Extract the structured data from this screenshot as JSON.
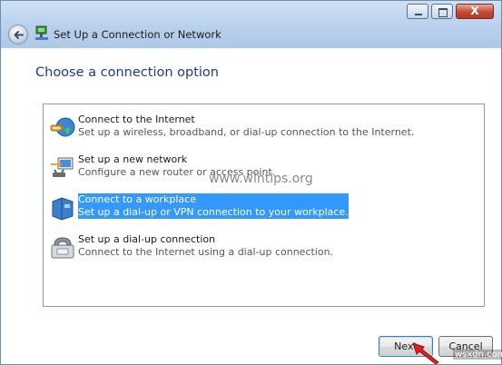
{
  "window": {
    "title": "Set Up a Connection or Network",
    "caption": {
      "close_label": "X"
    }
  },
  "heading": "Choose a connection option",
  "options": [
    {
      "title": "Connect to the Internet",
      "description": "Set up a wireless, broadband, or dial-up connection to the Internet.",
      "icon": "globe-internet-icon",
      "selected": false
    },
    {
      "title": "Set up a new network",
      "description": "Configure a new router or access point.",
      "icon": "new-network-icon",
      "selected": false
    },
    {
      "title": "Connect to a workplace",
      "description": "Set up a dial-up or VPN connection to your workplace.",
      "icon": "workplace-icon",
      "selected": true
    },
    {
      "title": "Set up a dial-up connection",
      "description": "Connect to the Internet using a dial-up connection.",
      "icon": "phone-modem-icon",
      "selected": false
    }
  ],
  "watermark": "www.wintips.org",
  "buttons": {
    "next_label": "Next",
    "cancel_label": "Cancel"
  },
  "corner_watermark": "wsxdn.com",
  "colors": {
    "heading": "#1e3a8c",
    "selection": "#3399ff",
    "arrow": "#e02020"
  }
}
